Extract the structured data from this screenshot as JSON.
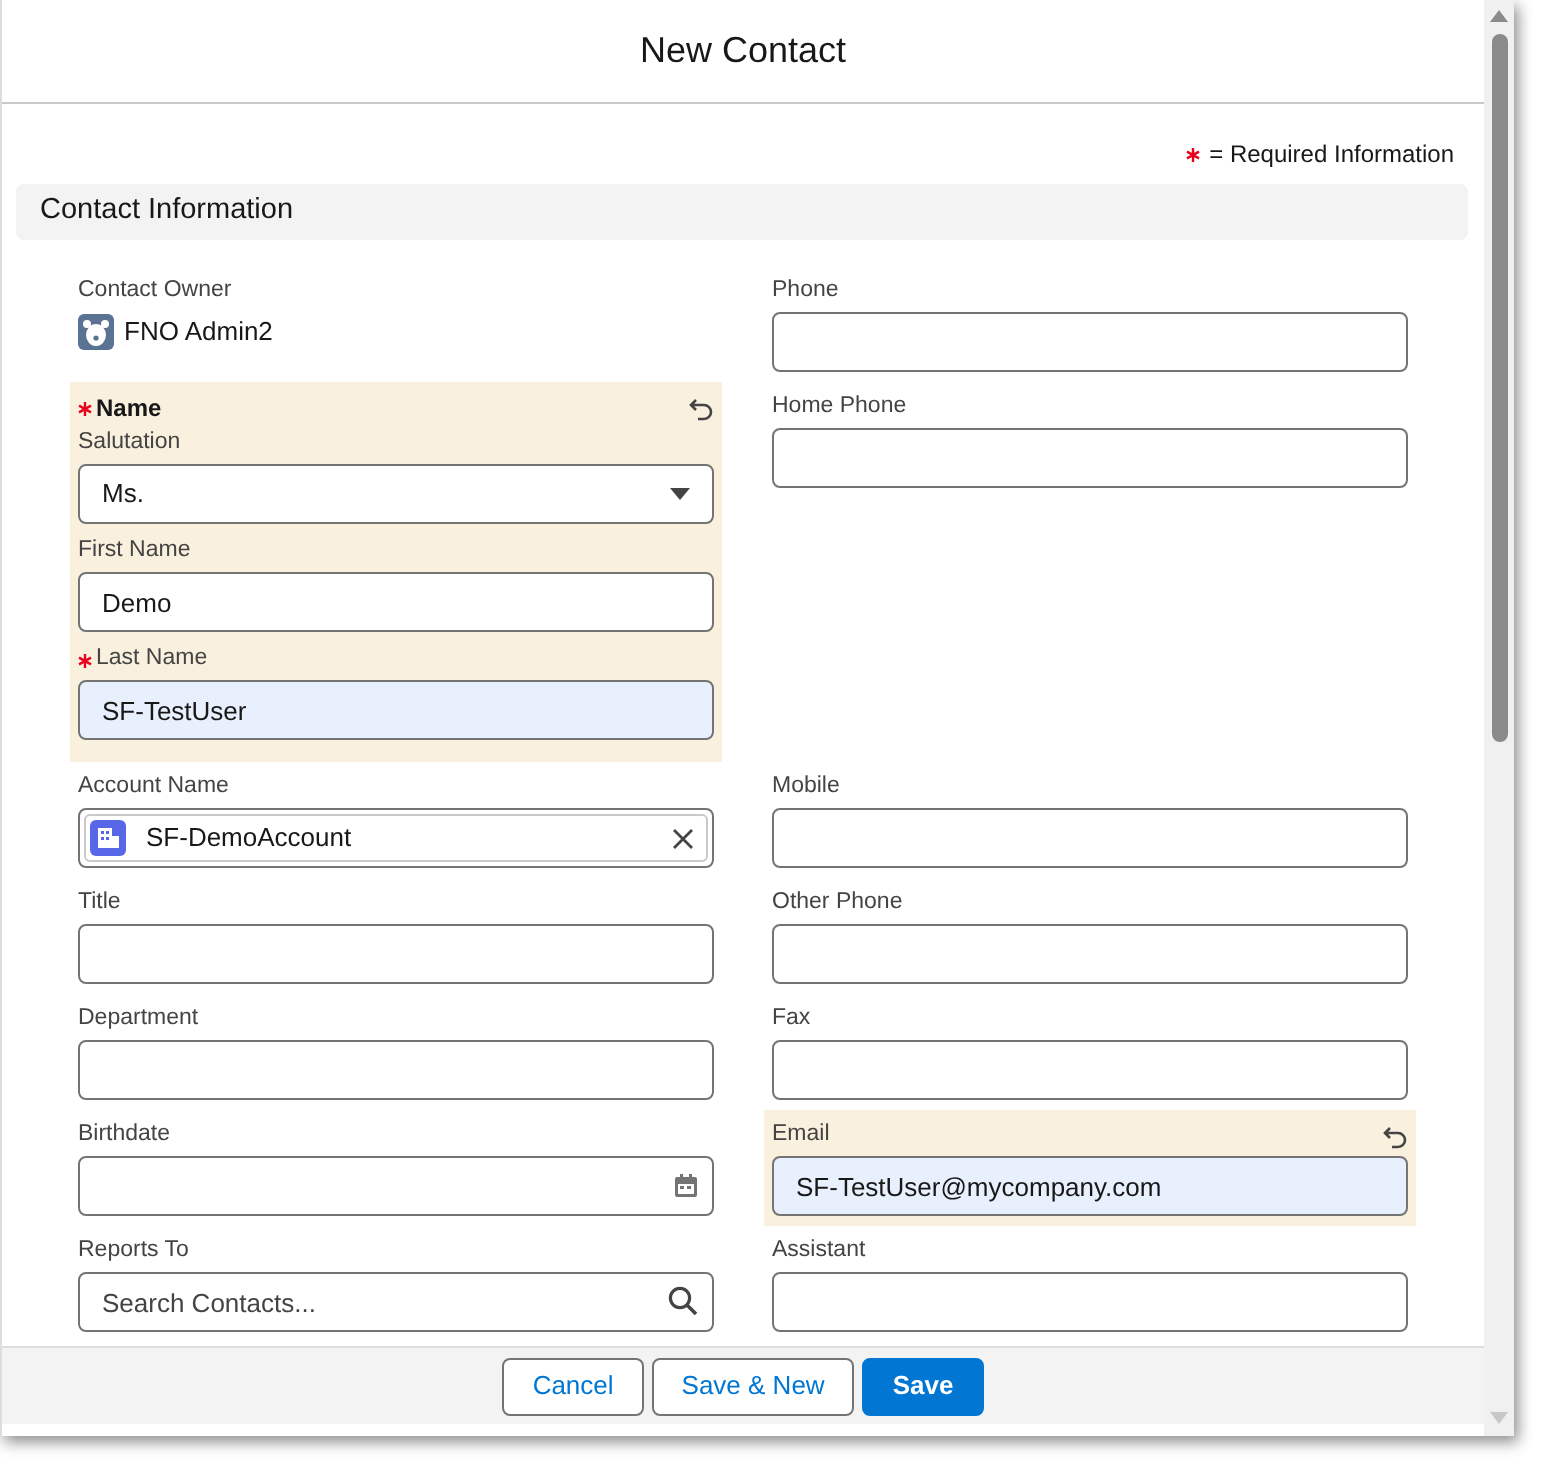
{
  "modal": {
    "title": "New Contact"
  },
  "required_note": {
    "text": "= Required Information"
  },
  "section": {
    "title": "Contact Information"
  },
  "rows": [
    {
      "left": {
        "kind": "owner",
        "label": "Contact Owner",
        "value": "FNO Admin2"
      },
      "right": {
        "kind": "text",
        "label": "Phone",
        "required": false,
        "edited": false,
        "autofilled": false
      }
    },
    {
      "left": {
        "kind": "group",
        "label": "Name",
        "required": true,
        "edited": true,
        "fields": [
          {
            "kind": "select",
            "label": "Salutation",
            "value": "Ms.",
            "required": false,
            "autofilled": false
          },
          {
            "kind": "text",
            "label": "First Name",
            "value": "Demo",
            "required": false,
            "autofilled": false
          },
          {
            "kind": "text",
            "label": "Last Name",
            "value": "SF-TestUser",
            "required": true,
            "autofilled": true
          }
        ]
      },
      "right": {
        "kind": "text",
        "label": "Home Phone",
        "required": false,
        "edited": false,
        "autofilled": false
      }
    },
    {
      "left": {
        "kind": "lookup",
        "label": "Account Name",
        "value": "SF-DemoAccount",
        "required": false,
        "edited": false
      },
      "right": {
        "kind": "text",
        "label": "Mobile",
        "required": false,
        "edited": false,
        "autofilled": false
      }
    },
    {
      "left": {
        "kind": "text",
        "label": "Title",
        "required": false,
        "edited": false,
        "autofilled": false
      },
      "right": {
        "kind": "text",
        "label": "Other Phone",
        "required": false,
        "edited": false,
        "autofilled": false
      }
    },
    {
      "left": {
        "kind": "text",
        "label": "Department",
        "required": false,
        "edited": false,
        "autofilled": false
      },
      "right": {
        "kind": "text",
        "label": "Fax",
        "required": false,
        "edited": false,
        "autofilled": false
      }
    },
    {
      "left": {
        "kind": "date",
        "label": "Birthdate",
        "required": false,
        "edited": false,
        "autofilled": false
      },
      "right": {
        "kind": "text",
        "label": "Email",
        "value": "SF-TestUser@mycompany.com",
        "required": false,
        "edited": true,
        "autofilled": true
      }
    },
    {
      "left": {
        "kind": "search",
        "label": "Reports To",
        "placeholder": "Search Contacts...",
        "required": false,
        "edited": false
      },
      "right": {
        "kind": "text",
        "label": "Assistant",
        "required": false,
        "edited": false,
        "autofilled": false
      }
    }
  ],
  "footer": {
    "buttons": [
      {
        "label": "Cancel",
        "kind": "neutral"
      },
      {
        "label": "Save & New",
        "kind": "neutral"
      },
      {
        "label": "Save",
        "kind": "brand"
      }
    ]
  }
}
